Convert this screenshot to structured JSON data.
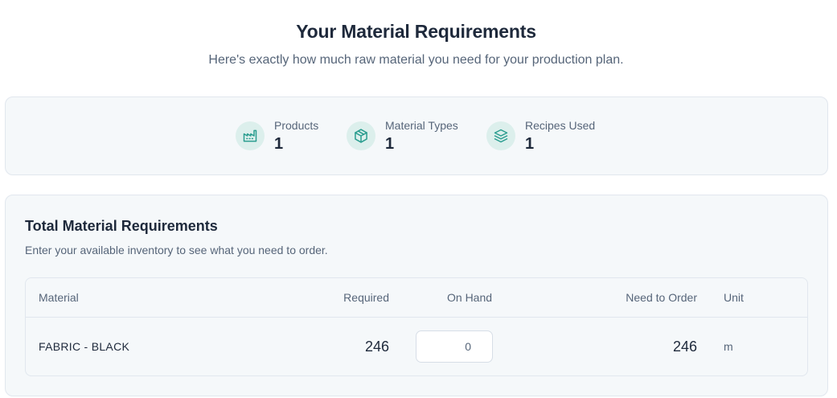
{
  "header": {
    "title": "Your Material Requirements",
    "subtitle": "Here's exactly how much raw material you need for your production plan."
  },
  "stats": [
    {
      "label": "Products",
      "value": "1",
      "icon": "factory-icon"
    },
    {
      "label": "Material Types",
      "value": "1",
      "icon": "box-icon"
    },
    {
      "label": "Recipes Used",
      "value": "1",
      "icon": "layers-icon"
    }
  ],
  "requirements": {
    "title": "Total Material Requirements",
    "subtitle": "Enter your available inventory to see what you need to order.",
    "columns": {
      "material": "Material",
      "required": "Required",
      "on_hand": "On Hand",
      "need_to_order": "Need to Order",
      "unit": "Unit"
    },
    "rows": [
      {
        "material": "FABRIC - BLACK",
        "required": "246",
        "on_hand": "0",
        "need_to_order": "246",
        "unit": "m"
      }
    ]
  },
  "colors": {
    "accent": "#2a9d8f",
    "icon_bg": "#dcefec",
    "card_bg": "#f5f8fa",
    "border": "#e1e7ee"
  }
}
